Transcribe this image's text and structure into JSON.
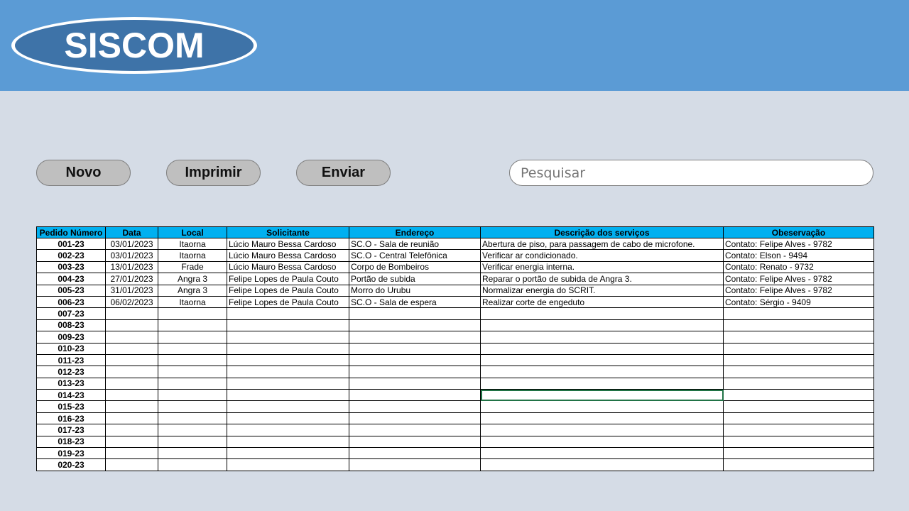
{
  "header": {
    "logo_text": "SISCOM",
    "colors": {
      "header_bg": "#5b9bd5",
      "logo_fill": "#3e73a8",
      "page_bg": "#d5dce6"
    }
  },
  "toolbar": {
    "novo_label": "Novo",
    "imprimir_label": "Imprimir",
    "enviar_label": "Enviar"
  },
  "search": {
    "placeholder": "Pesquisar",
    "value": ""
  },
  "table": {
    "header_color": "#00b0f0",
    "columns": [
      "Pedido Número",
      "Data",
      "Local",
      "Solicitante",
      "Endereço",
      "Descrição dos serviços",
      "Obeservação"
    ],
    "rows": [
      [
        "001-23",
        "03/01/2023",
        "Itaorna",
        "Lúcio Mauro Bessa Cardoso",
        "SC.O - Sala de reunião",
        "Abertura de piso, para passagem de cabo de microfone.",
        "Contato: Felipe Alves - 9782"
      ],
      [
        "002-23",
        "03/01/2023",
        "Itaorna",
        "Lúcio Mauro Bessa Cardoso",
        "SC.O - Central Telefônica",
        "Verificar ar condicionado.",
        "Contato: Elson - 9494"
      ],
      [
        "003-23",
        "13/01/2023",
        "Frade",
        "Lúcio Mauro Bessa Cardoso",
        "Corpo de Bombeiros",
        "Verificar energia interna.",
        "Contato: Renato - 9732"
      ],
      [
        "004-23",
        "27/01/2023",
        "Angra 3",
        "Felipe Lopes de Paula Couto",
        "Portão de subida",
        "Reparar o portão de subida de Angra 3.",
        "Contato: Felipe Alves - 9782"
      ],
      [
        "005-23",
        "31/01/2023",
        "Angra 3",
        "Felipe Lopes de Paula Couto",
        "Morro do Urubu",
        "Normalizar energia do SCRIT.",
        "Contato: Felipe Alves - 9782"
      ],
      [
        "006-23",
        "06/02/2023",
        "Itaorna",
        "Felipe Lopes de Paula Couto",
        "SC.O - Sala de espera",
        "Realizar corte de engeduto",
        "Contato: Sérgio - 9409"
      ],
      [
        "007-23",
        "",
        "",
        "",
        "",
        "",
        ""
      ],
      [
        "008-23",
        "",
        "",
        "",
        "",
        "",
        ""
      ],
      [
        "009-23",
        "",
        "",
        "",
        "",
        "",
        ""
      ],
      [
        "010-23",
        "",
        "",
        "",
        "",
        "",
        ""
      ],
      [
        "011-23",
        "",
        "",
        "",
        "",
        "",
        ""
      ],
      [
        "012-23",
        "",
        "",
        "",
        "",
        "",
        ""
      ],
      [
        "013-23",
        "",
        "",
        "",
        "",
        "",
        ""
      ],
      [
        "014-23",
        "",
        "",
        "",
        "",
        "",
        ""
      ],
      [
        "015-23",
        "",
        "",
        "",
        "",
        "",
        ""
      ],
      [
        "016-23",
        "",
        "",
        "",
        "",
        "",
        ""
      ],
      [
        "017-23",
        "",
        "",
        "",
        "",
        "",
        ""
      ],
      [
        "018-23",
        "",
        "",
        "",
        "",
        "",
        ""
      ],
      [
        "019-23",
        "",
        "",
        "",
        "",
        "",
        ""
      ],
      [
        "020-23",
        "",
        "",
        "",
        "",
        "",
        ""
      ]
    ]
  }
}
